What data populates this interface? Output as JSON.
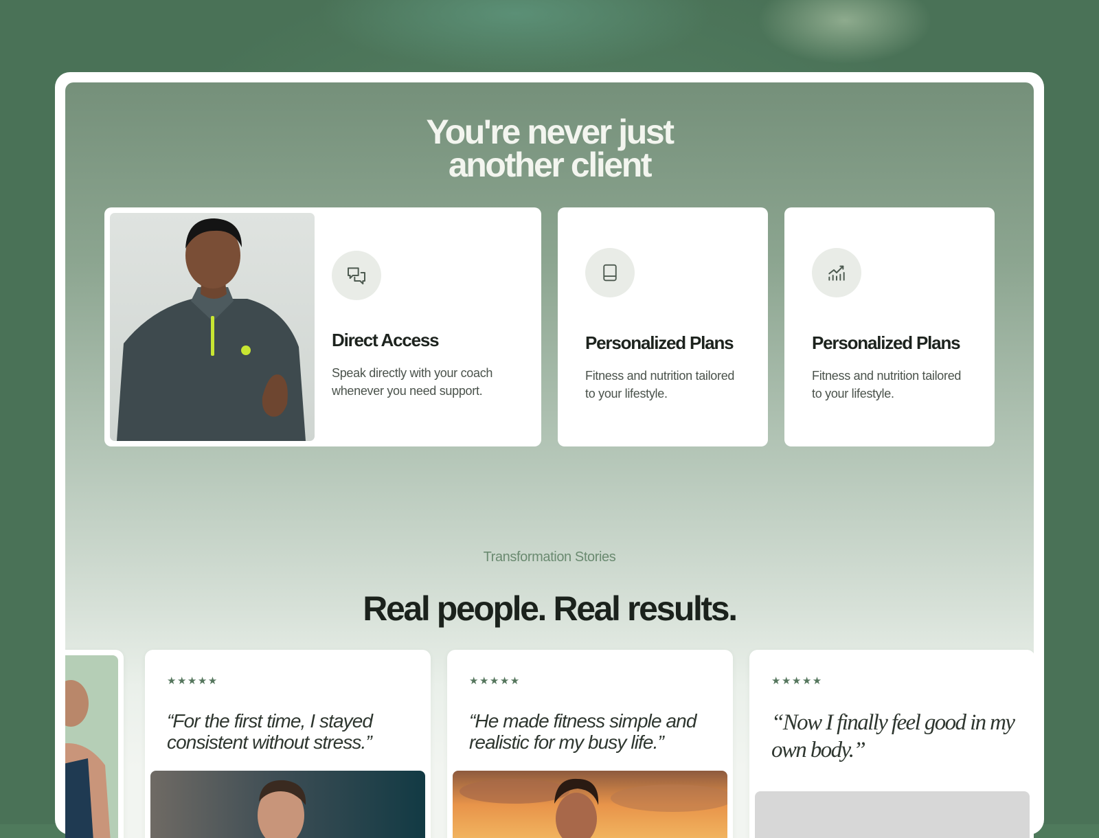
{
  "hero": {
    "title_line1": "You're never just",
    "title_line2": "another client"
  },
  "features": [
    {
      "icon": "chat-bubbles-icon",
      "title": "Direct Access",
      "text_line1": "Speak directly with your coach",
      "text_line2": "whenever you need support."
    },
    {
      "icon": "book-icon",
      "title": "Personalized Plans",
      "text_line1": "Fitness and nutrition tailored",
      "text_line2": "to your lifestyle."
    },
    {
      "icon": "chart-icon",
      "title": "Personalized Plans",
      "text_line1": "Fitness and nutrition tailored",
      "text_line2": "to your lifestyle."
    }
  ],
  "testimonials_section": {
    "eyebrow": "Transformation Stories",
    "title": "Real people. Real results."
  },
  "testimonials": [
    {
      "stars": "★★★★★",
      "rating": 5,
      "quote_line1": "“For the first time, I stayed",
      "quote_line2": "consistent without stress.”"
    },
    {
      "stars": "★★★★★",
      "rating": 5,
      "quote_line1": "“He made fitness simple and",
      "quote_line2": "realistic for my busy life.”"
    },
    {
      "stars": "★★★★★",
      "rating": 5,
      "quote_line1": "“Now I finally feel good in my",
      "quote_line2": "own body.”"
    }
  ],
  "colors": {
    "accent_green": "#55765d",
    "background_green": "#4f7a5c",
    "heading_dark": "#1b221c"
  }
}
